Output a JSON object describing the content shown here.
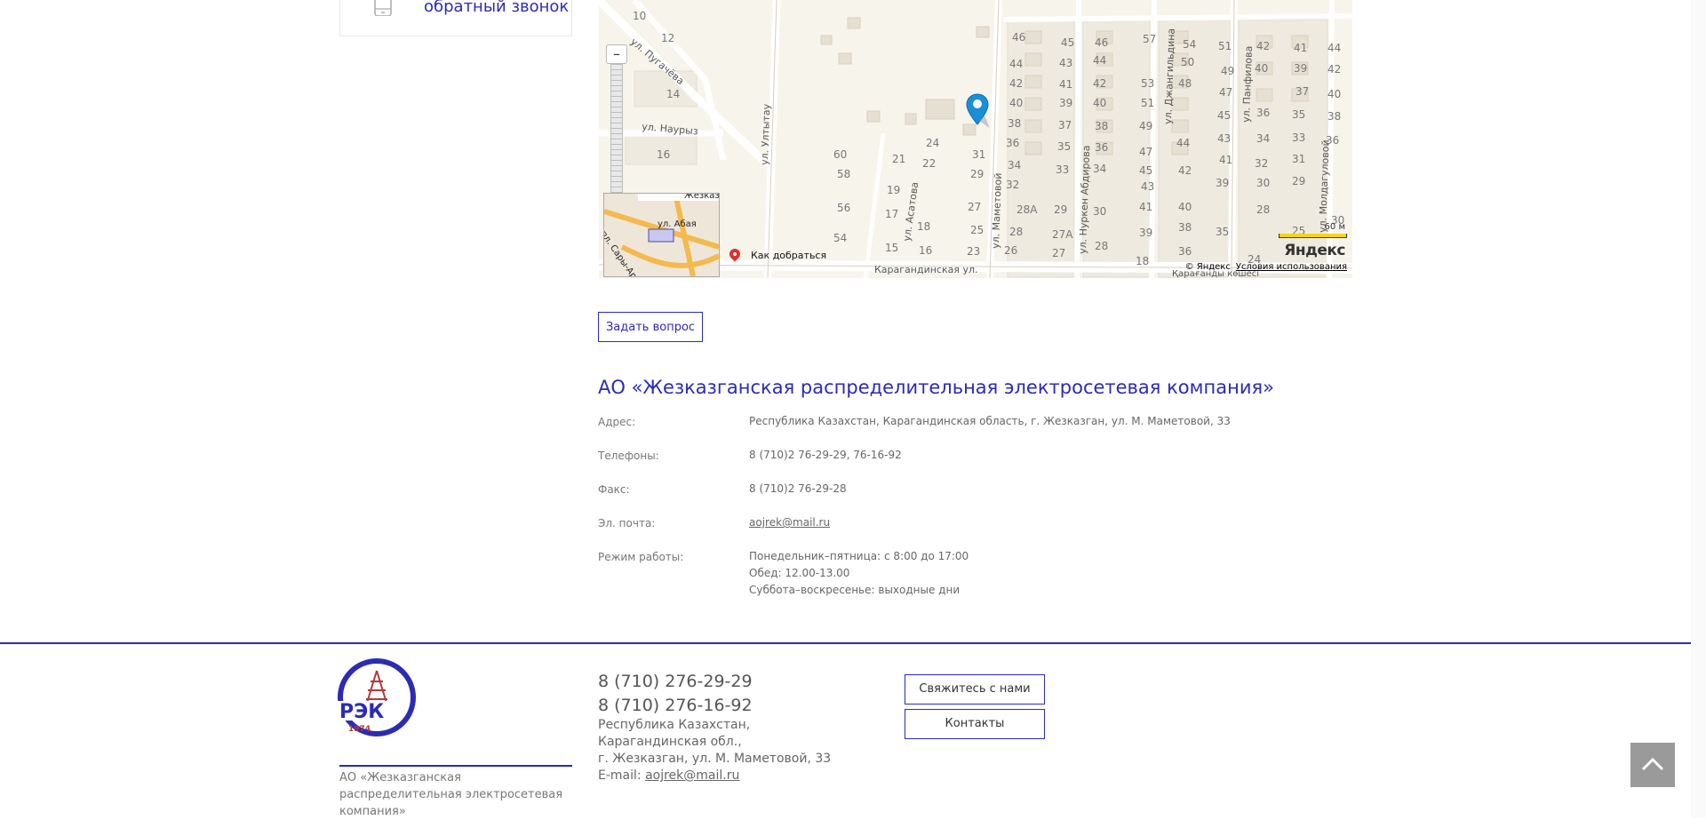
{
  "sidebar": {
    "callback_label": "обратный звонок",
    "phone_icon": "smartphone-icon"
  },
  "map": {
    "street_labels": [
      "ул. Пугачёва",
      "ул. Наурыз",
      "ул. Ултытау",
      "ул. Асатова",
      "ул. Маметовой",
      "ул. Нуркен Абдирова",
      "ул. Джангильдина",
      "ул. Панфилова",
      "ул. Молдагуловой",
      "Карагандинская ул.",
      "Қарағанды көшесі"
    ],
    "house_numbers": [
      "10",
      "12",
      "14",
      "16",
      "60",
      "58",
      "56",
      "54",
      "21",
      "22",
      "24",
      "19",
      "17",
      "18",
      "16",
      "15",
      "31",
      "29",
      "27",
      "25",
      "23",
      "26",
      "28",
      "28А",
      "27А",
      "27",
      "29",
      "30",
      "46",
      "44",
      "42",
      "40",
      "38",
      "36",
      "34",
      "32",
      "45",
      "43",
      "41",
      "39",
      "37",
      "35",
      "33",
      "46",
      "44",
      "42",
      "40",
      "38",
      "36",
      "34",
      "30",
      "28",
      "57",
      "53",
      "51",
      "49",
      "47",
      "45",
      "43",
      "41",
      "39",
      "18",
      "54",
      "50",
      "48",
      "44",
      "42",
      "40",
      "38",
      "36",
      "51",
      "49",
      "47",
      "45",
      "43",
      "41",
      "39",
      "35",
      "42",
      "40",
      "36",
      "34",
      "32",
      "30",
      "28",
      "24",
      "41",
      "39",
      "37",
      "35",
      "33",
      "31",
      "29",
      "25",
      "44",
      "42",
      "40",
      "38",
      "36",
      "30"
    ],
    "minimap_street_1": "ул. Абая",
    "minimap_street_2": "пл. Сары-Арка",
    "minimap_text": "Жезказ",
    "route_label": "Как добраться",
    "copyright": "© Яндекс",
    "terms_link": "Условия использования",
    "logo": "Яндекс",
    "scale": "60 м",
    "zoom_minus": "–"
  },
  "ask_button": "Задать вопрос",
  "company": {
    "title": "АО «Жезказганская распределительная электросетевая компания»",
    "rows": [
      {
        "label": "Адрес:",
        "value": "Республика Казахстан, Карагандинская область, г. Жезказган, ул. М. Маметовой, 33"
      },
      {
        "label": "Телефоны:",
        "value": "8 (710)2 76-29-29, 76-16-92"
      },
      {
        "label": "Факс:",
        "value": "8 (710)2 76-29-28"
      },
      {
        "label": "Эл. почта:",
        "value": "aojrek@mail.ru"
      },
      {
        "label": "Режим работы:",
        "lines": [
          "Понедельник–пятница: с 8:00 до 17:00",
          "Обед: 12.00-13.00",
          "Суббота–воскресенье: выходные дни"
        ]
      }
    ]
  },
  "footer": {
    "logo_text": "РЭК",
    "logo_year": "1974",
    "logo_arc_text": "ЖЕЗКАЗГАНСКАЯ",
    "company_name": "АО «Жезказганская распределительная электросетевая компания»",
    "phone_1": "8 (710) 276-29-29",
    "phone_2": "8 (710) 276-16-92",
    "address_lines": [
      "Республика Казахстан,",
      "Карагандинская обл.,",
      "г. Жезказган, ул. М. Маметовой, 33"
    ],
    "email_label": "E-mail:",
    "email": "aojrek@mail.ru",
    "contact_button": "Свяжитесь с нами",
    "contacts_button": "Контакты"
  },
  "scroll_top_icon": "chevron-up-icon",
  "colors": {
    "accent": "#2b2bb5",
    "map_bg": "#f7f4ec",
    "pin": "#1a8fd6"
  }
}
